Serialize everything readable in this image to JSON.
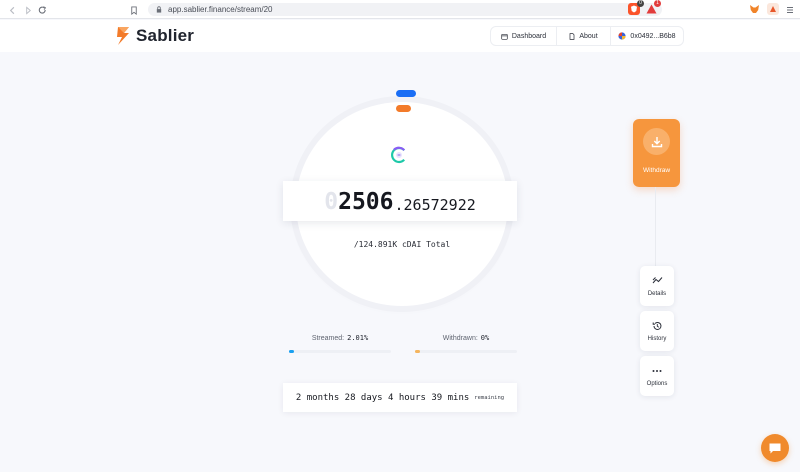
{
  "browser": {
    "url": "app.sablier.finance/stream/20",
    "brave_badge": "0",
    "alert_badge": "1"
  },
  "header": {
    "brand": "Sablier",
    "nav": {
      "dashboard": "Dashboard",
      "about": "About",
      "account": "0x0492...B6b8"
    }
  },
  "stream": {
    "amount_leading_zero": "0",
    "amount_integer": "2506",
    "amount_decimal": ".26572922",
    "total": "/124.891K cDAI Total",
    "streamed_label": "Streamed:",
    "streamed_value": "2.01%",
    "streamed_fraction": 0.0201,
    "withdrawn_label": "Withdrawn:",
    "withdrawn_value": "0%",
    "withdrawn_fraction": 0,
    "remaining_time": "2 months 28 days 4 hours 39 mins",
    "remaining_label": "remaining"
  },
  "actions": {
    "withdraw": "Withdraw",
    "details": "Details",
    "history": "History",
    "options": "Options"
  },
  "colors": {
    "accent_orange": "#f37b2a",
    "withdraw_orange": "#f6963d",
    "stream_blue": "#1a6ef5",
    "withdraw_bar": "#f5b55e"
  },
  "icons": [
    "back-icon",
    "forward-icon",
    "reload-icon",
    "bookmark-icon",
    "lock-icon",
    "brave-shield-icon",
    "alert-icon",
    "metamask-icon",
    "extension-icon",
    "menu-icon",
    "sablier-logo",
    "calendar-icon",
    "document-icon",
    "avatar-icon",
    "cdai-token-icon",
    "download-icon",
    "chart-icon",
    "history-icon",
    "more-icon",
    "chat-icon"
  ]
}
